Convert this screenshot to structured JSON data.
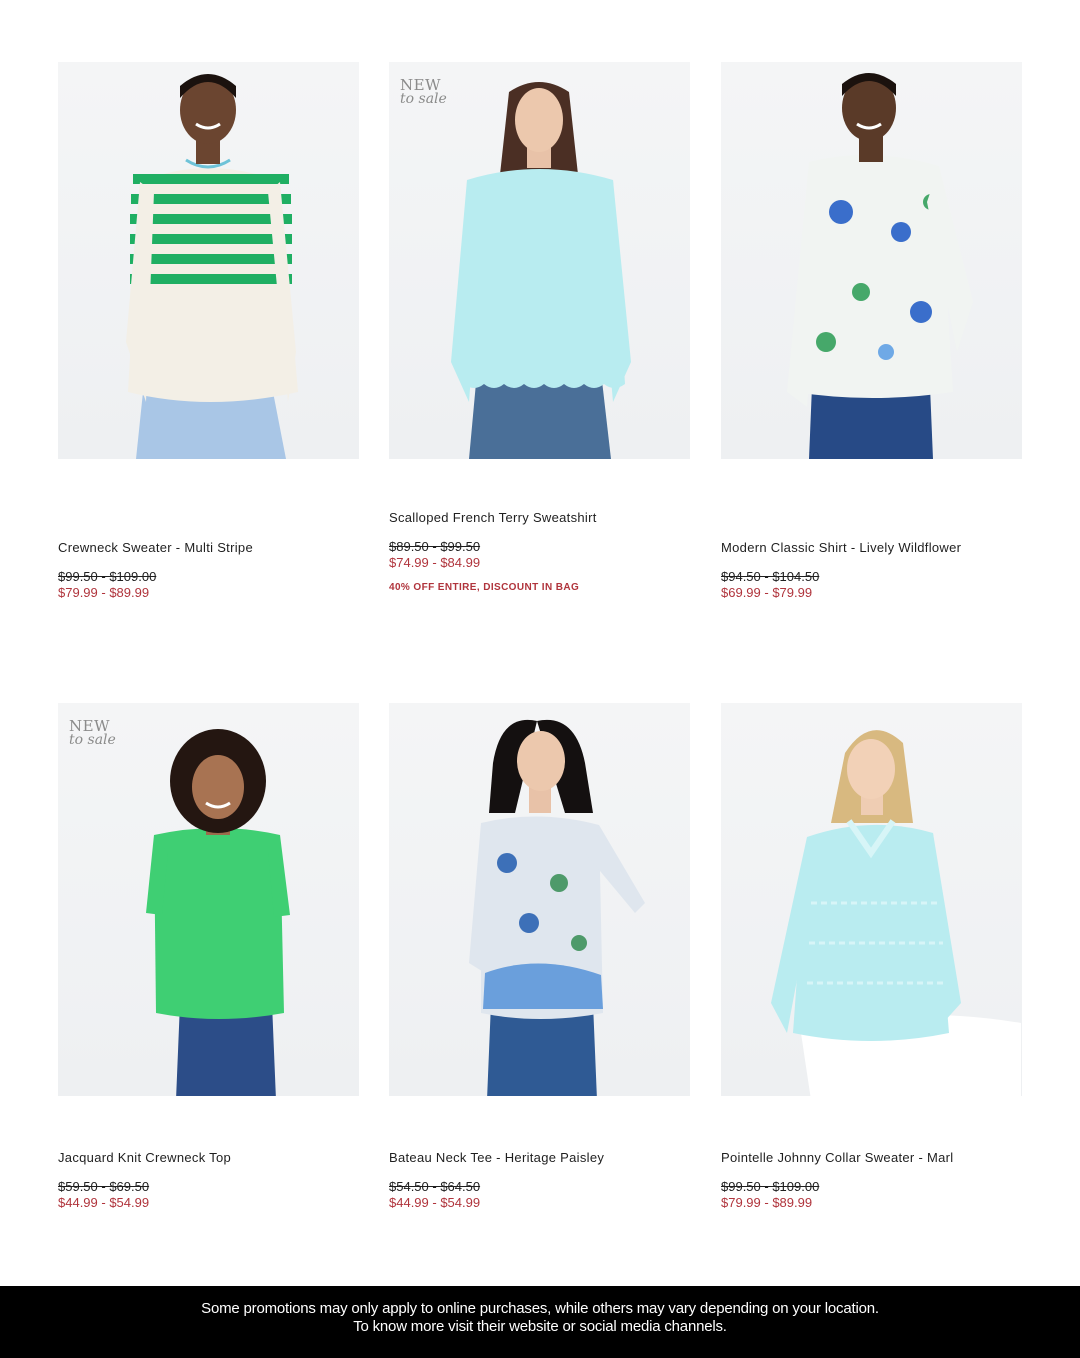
{
  "products": [
    {
      "name": "Crewneck Sweater - Multi Stripe",
      "original_price": "$99.50 - $109.00",
      "sale_price": "$79.99 - $89.99",
      "badge": null,
      "promo": null,
      "image_alt": "Model wearing ivory sweater with green stripes"
    },
    {
      "name": "Scalloped French Terry Sweatshirt",
      "original_price": "$89.50 - $99.50",
      "sale_price": "$74.99 - $84.99",
      "badge": {
        "line1": "NEW",
        "line2": "to sale"
      },
      "promo": "40% OFF ENTIRE, DISCOUNT IN BAG",
      "image_alt": "Model wearing light aqua scalloped sweatshirt"
    },
    {
      "name": "Modern Classic Shirt - Lively Wildflower",
      "original_price": "$94.50 - $104.50",
      "sale_price": "$69.99 - $79.99",
      "badge": null,
      "promo": null,
      "image_alt": "Model wearing white floral print shirt"
    },
    {
      "name": "Jacquard Knit Crewneck Top",
      "original_price": "$59.50 - $69.50",
      "sale_price": "$44.99 - $54.99",
      "badge": {
        "line1": "NEW",
        "line2": "to sale"
      },
      "promo": null,
      "image_alt": "Model wearing green short sleeve top"
    },
    {
      "name": "Bateau Neck Tee - Heritage Paisley",
      "original_price": "$54.50 - $64.50",
      "sale_price": "$44.99 - $54.99",
      "badge": null,
      "promo": null,
      "image_alt": "Model wearing paisley print tee"
    },
    {
      "name": "Pointelle Johnny Collar Sweater - Marl",
      "original_price": "$99.50 - $109.00",
      "sale_price": "$79.99 - $89.99",
      "badge": null,
      "promo": null,
      "image_alt": "Model wearing aqua pointelle sweater"
    }
  ],
  "footer": {
    "line1": "Some promotions may only apply to online purchases, while others may vary depending on your location.",
    "line2": "To know more visit their website or social media channels."
  },
  "colors": {
    "sale_red": "#b0343c",
    "footer_bg": "#000000",
    "badge_gray": "#8b8b8b"
  }
}
